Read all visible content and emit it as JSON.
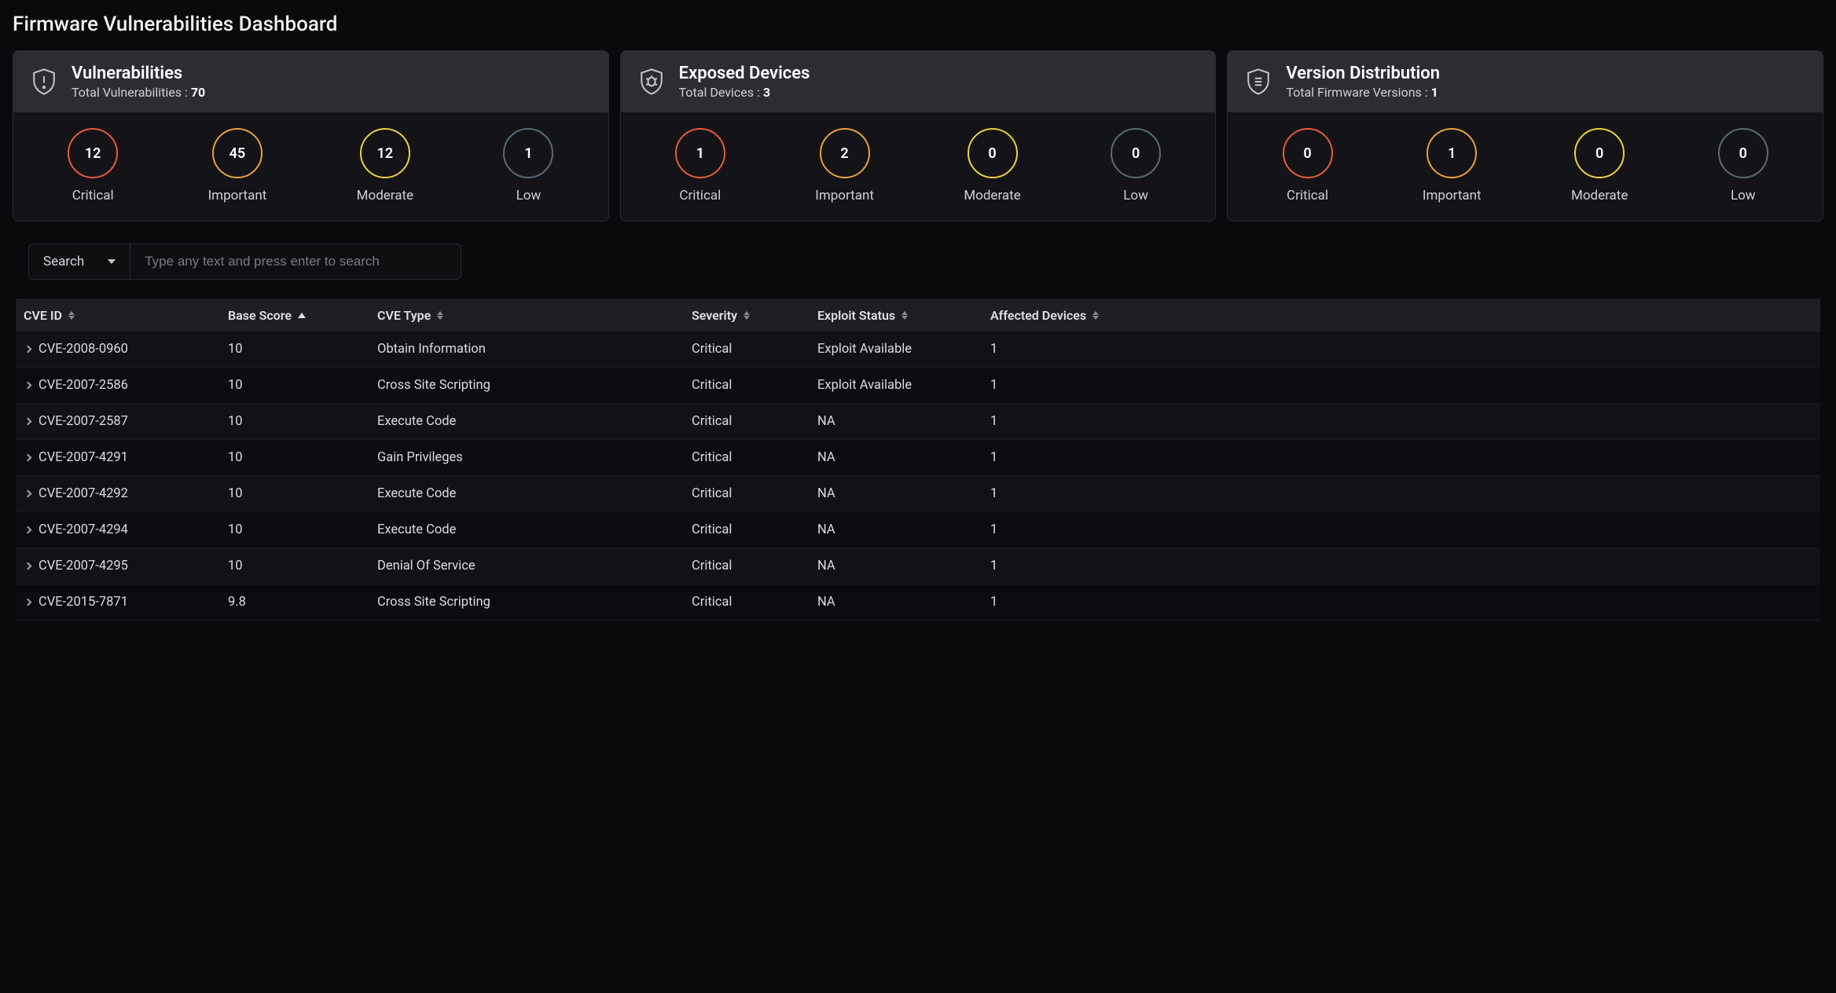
{
  "page": {
    "title": "Firmware Vulnerabilities Dashboard"
  },
  "cards": {
    "vulnerabilities": {
      "title": "Vulnerabilities",
      "subLabel": "Total Vulnerabilities : ",
      "subCount": "70",
      "items": [
        {
          "count": "12",
          "label": "Critical",
          "cls": "ring-critical"
        },
        {
          "count": "45",
          "label": "Important",
          "cls": "ring-important"
        },
        {
          "count": "12",
          "label": "Moderate",
          "cls": "ring-moderate"
        },
        {
          "count": "1",
          "label": "Low",
          "cls": "ring-low"
        }
      ]
    },
    "exposedDevices": {
      "title": "Exposed Devices",
      "subLabel": "Total Devices : ",
      "subCount": "3",
      "items": [
        {
          "count": "1",
          "label": "Critical",
          "cls": "ring-critical"
        },
        {
          "count": "2",
          "label": "Important",
          "cls": "ring-important"
        },
        {
          "count": "0",
          "label": "Moderate",
          "cls": "ring-moderate"
        },
        {
          "count": "0",
          "label": "Low",
          "cls": "ring-low"
        }
      ]
    },
    "versionDistribution": {
      "title": "Version Distribution",
      "subLabel": "Total Firmware Versions : ",
      "subCount": "1",
      "items": [
        {
          "count": "0",
          "label": "Critical",
          "cls": "ring-critical"
        },
        {
          "count": "1",
          "label": "Important",
          "cls": "ring-important"
        },
        {
          "count": "0",
          "label": "Moderate",
          "cls": "ring-moderate"
        },
        {
          "count": "0",
          "label": "Low",
          "cls": "ring-low"
        }
      ]
    }
  },
  "search": {
    "selectLabel": "Search",
    "placeholder": "Type any text and press enter to search",
    "value": ""
  },
  "table": {
    "columns": {
      "cveId": "CVE ID",
      "baseScore": "Base Score",
      "cveType": "CVE Type",
      "severity": "Severity",
      "exploitStatus": "Exploit Status",
      "affectedDevices": "Affected Devices"
    },
    "rows": [
      {
        "cveId": "CVE-2008-0960",
        "baseScore": "10",
        "cveType": "Obtain Information",
        "severity": "Critical",
        "exploitStatus": "Exploit Available",
        "affectedDevices": "1"
      },
      {
        "cveId": "CVE-2007-2586",
        "baseScore": "10",
        "cveType": "Cross Site Scripting",
        "severity": "Critical",
        "exploitStatus": "Exploit Available",
        "affectedDevices": "1"
      },
      {
        "cveId": "CVE-2007-2587",
        "baseScore": "10",
        "cveType": "Execute Code",
        "severity": "Critical",
        "exploitStatus": "NA",
        "affectedDevices": "1"
      },
      {
        "cveId": "CVE-2007-4291",
        "baseScore": "10",
        "cveType": "Gain Privileges",
        "severity": "Critical",
        "exploitStatus": "NA",
        "affectedDevices": "1"
      },
      {
        "cveId": "CVE-2007-4292",
        "baseScore": "10",
        "cveType": "Execute Code",
        "severity": "Critical",
        "exploitStatus": "NA",
        "affectedDevices": "1"
      },
      {
        "cveId": "CVE-2007-4294",
        "baseScore": "10",
        "cveType": "Execute Code",
        "severity": "Critical",
        "exploitStatus": "NA",
        "affectedDevices": "1"
      },
      {
        "cveId": "CVE-2007-4295",
        "baseScore": "10",
        "cveType": "Denial Of Service",
        "severity": "Critical",
        "exploitStatus": "NA",
        "affectedDevices": "1"
      },
      {
        "cveId": "CVE-2015-7871",
        "baseScore": "9.8",
        "cveType": "Cross Site Scripting",
        "severity": "Critical",
        "exploitStatus": "NA",
        "affectedDevices": "1"
      }
    ]
  }
}
